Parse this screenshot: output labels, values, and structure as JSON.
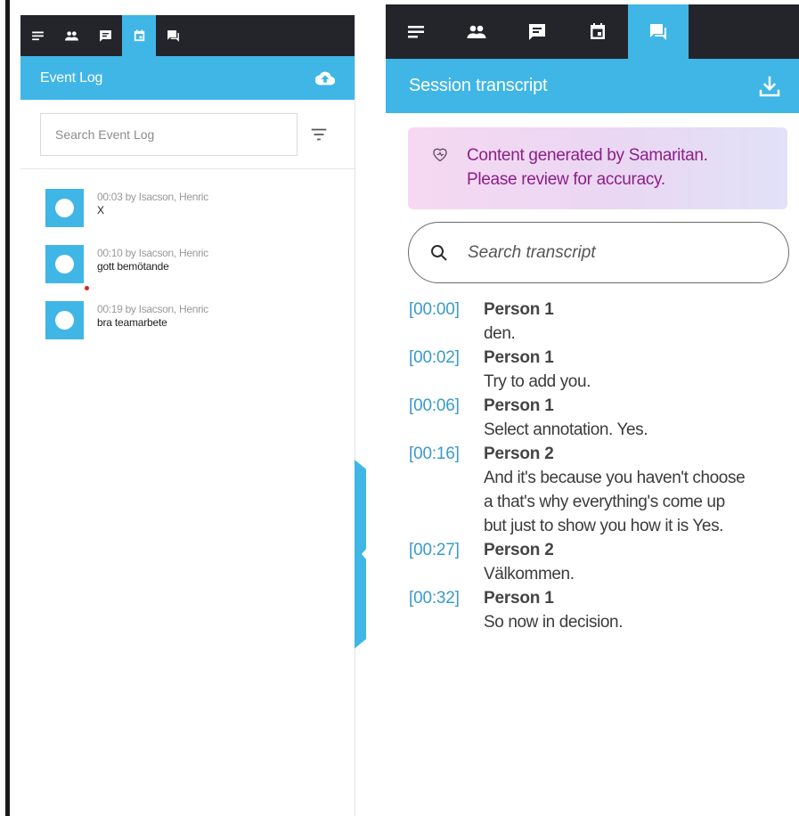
{
  "event_log_panel": {
    "tabs": [
      {
        "icon": "notes-icon"
      },
      {
        "icon": "people-icon"
      },
      {
        "icon": "comment-icon"
      },
      {
        "icon": "calendar-icon",
        "active": true
      },
      {
        "icon": "chat-icon"
      }
    ],
    "title": "Event Log",
    "header_icon": "cloud-upload-icon",
    "search_placeholder": "Search Event Log",
    "events": [
      {
        "meta": "00:03 by Isacson, Henric",
        "text": "X"
      },
      {
        "meta": "00:10 by Isacson, Henric",
        "text": "gott bemötande"
      },
      {
        "meta": "00:19 by Isacson, Henric",
        "text": "bra teamarbete"
      }
    ]
  },
  "transcript_panel": {
    "tabs": [
      {
        "icon": "notes-icon"
      },
      {
        "icon": "people-icon"
      },
      {
        "icon": "comment-icon"
      },
      {
        "icon": "calendar-icon"
      },
      {
        "icon": "chat-icon",
        "active": true
      }
    ],
    "title": "Session transcript",
    "header_icon": "download-icon",
    "notice": {
      "line1": "Content generated by Samaritan.",
      "line2": "Please review for accuracy."
    },
    "search_placeholder": "Search transcript",
    "entries": [
      {
        "time": "[00:00]",
        "speaker": "Person 1",
        "lines": [
          "den."
        ]
      },
      {
        "time": "[00:02]",
        "speaker": "Person 1",
        "lines": [
          "Try to add you."
        ]
      },
      {
        "time": "[00:06]",
        "speaker": "Person 1",
        "lines": [
          "Select annotation. Yes."
        ]
      },
      {
        "time": "[00:16]",
        "speaker": "Person 2",
        "lines": [
          "And it's because you haven't choose",
          "a that's why everything's come up",
          "but just to show you how it is Yes."
        ]
      },
      {
        "time": "[00:27]",
        "speaker": "Person 2",
        "lines": [
          "Välkommen."
        ]
      },
      {
        "time": "[00:32]",
        "speaker": "Person 1",
        "lines": [
          "So now in decision."
        ]
      }
    ]
  },
  "colors": {
    "accent": "#3fb6e6",
    "tabbar": "#24252b",
    "notice_text": "#8b1f87",
    "timestamp": "#3a9bc9"
  }
}
